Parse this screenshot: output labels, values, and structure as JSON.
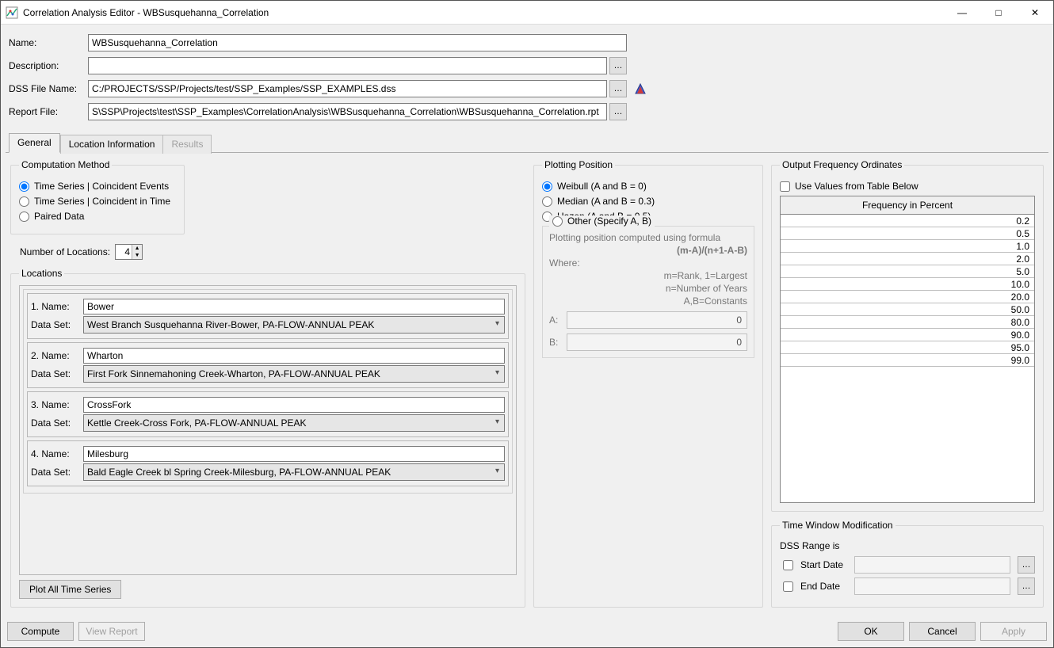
{
  "window": {
    "title": "Correlation Analysis Editor - WBSusquehanna_Correlation"
  },
  "form": {
    "name_label": "Name:",
    "name_value": "WBSusquehanna_Correlation",
    "desc_label": "Description:",
    "desc_value": "",
    "dss_label": "DSS File Name:",
    "dss_value": "C:/PROJECTS/SSP/Projects/test/SSP_Examples/SSP_EXAMPLES.dss",
    "report_label": "Report File:",
    "report_value": "S\\SSP\\Projects\\test\\SSP_Examples\\CorrelationAnalysis\\WBSusquehanna_Correlation\\WBSusquehanna_Correlation.rpt",
    "ellipsis": "…"
  },
  "tabs": {
    "general": "General",
    "location": "Location Information",
    "results": "Results"
  },
  "comp_method": {
    "legend": "Computation Method",
    "opt1": "Time Series | Coincident Events",
    "opt2": "Time Series | Coincident in Time",
    "opt3": "Paired Data"
  },
  "numloc": {
    "label": "Number of Locations:",
    "value": "4"
  },
  "locations": {
    "legend": "Locations",
    "name_label_prefix": "Name:",
    "dataset_label": "Data Set:",
    "items": [
      {
        "idx": "1.",
        "name": "Bower",
        "dataset": "West Branch Susquehanna River-Bower, PA-FLOW-ANNUAL PEAK"
      },
      {
        "idx": "2.",
        "name": "Wharton",
        "dataset": "First Fork Sinnemahoning Creek-Wharton, PA-FLOW-ANNUAL PEAK"
      },
      {
        "idx": "3.",
        "name": "CrossFork",
        "dataset": "Kettle Creek-Cross Fork, PA-FLOW-ANNUAL PEAK"
      },
      {
        "idx": "4.",
        "name": "Milesburg",
        "dataset": "Bald Eagle Creek bl Spring Creek-Milesburg, PA-FLOW-ANNUAL PEAK"
      }
    ],
    "plot_btn": "Plot All Time Series"
  },
  "plotting": {
    "legend": "Plotting Position",
    "weibull": "Weibull (A and B = 0)",
    "median": "Median (A and B = 0.3)",
    "hazen": "Hazen (A and B = 0.5)",
    "other": "Other (Specify A, B)",
    "formula_intro": "Plotting position computed using formula",
    "formula": "(m-A)/(n+1-A-B)",
    "where": "Where:",
    "line_m": "m=Rank, 1=Largest",
    "line_n": "n=Number of Years",
    "line_ab": "A,B=Constants",
    "a_label": "A:",
    "b_label": "B:",
    "a_value": "0",
    "b_value": "0"
  },
  "freq": {
    "legend": "Output Frequency Ordinates",
    "use_table": "Use Values from Table Below",
    "header": "Frequency in Percent",
    "values": [
      "0.2",
      "0.5",
      "1.0",
      "2.0",
      "5.0",
      "10.0",
      "20.0",
      "50.0",
      "80.0",
      "90.0",
      "95.0",
      "99.0"
    ]
  },
  "timewin": {
    "legend": "Time Window Modification",
    "range": "DSS Range is",
    "start": "Start Date",
    "end": "End Date"
  },
  "footer": {
    "compute": "Compute",
    "view_report": "View Report",
    "ok": "OK",
    "cancel": "Cancel",
    "apply": "Apply"
  }
}
